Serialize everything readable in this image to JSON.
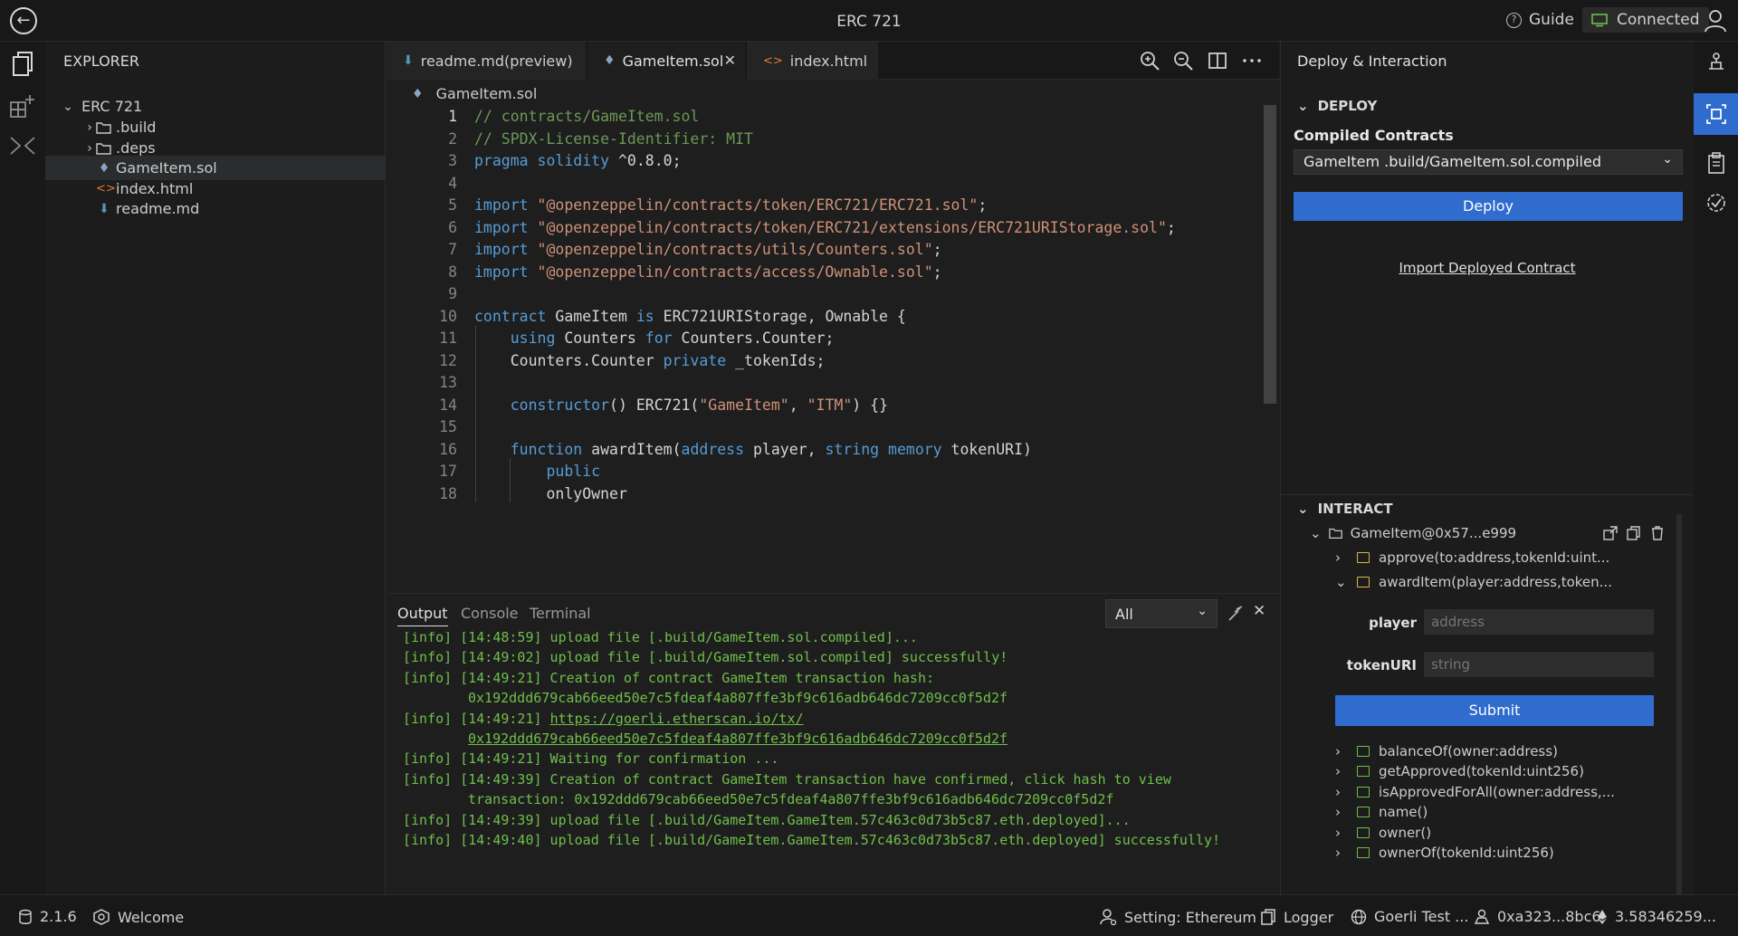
{
  "window": {
    "title": "ERC 721"
  },
  "titlebar": {
    "guide_label": "Guide",
    "connection_label": "Connected"
  },
  "explorer": {
    "title": "EXPLORER",
    "root": "ERC 721",
    "items": [
      {
        "label": ".build",
        "kind": "folder"
      },
      {
        "label": ".deps",
        "kind": "folder"
      },
      {
        "label": "GameItem.sol",
        "kind": "sol"
      },
      {
        "label": "index.html",
        "kind": "html"
      },
      {
        "label": "readme.md",
        "kind": "md"
      }
    ]
  },
  "editor": {
    "tabs": [
      {
        "label": "readme.md(preview)"
      },
      {
        "label": "GameItem.sol"
      },
      {
        "label": "index.html"
      }
    ],
    "close_glyph": "✕",
    "breadcrumb": "GameItem.sol",
    "lines": [
      {
        "n": "1",
        "text": "// contracts/GameItem.sol"
      },
      {
        "n": "2",
        "text": "// SPDX-License-Identifier: MIT"
      },
      {
        "n": "3",
        "text": "pragma solidity ^0.8.0;"
      },
      {
        "n": "4",
        "text": ""
      },
      {
        "n": "5",
        "text": "import \"@openzeppelin/contracts/token/ERC721/ERC721.sol\";"
      },
      {
        "n": "6",
        "text": "import \"@openzeppelin/contracts/token/ERC721/extensions/ERC721URIStorage.sol\";"
      },
      {
        "n": "7",
        "text": "import \"@openzeppelin/contracts/utils/Counters.sol\";"
      },
      {
        "n": "8",
        "text": "import \"@openzeppelin/contracts/access/Ownable.sol\";"
      },
      {
        "n": "9",
        "text": ""
      },
      {
        "n": "10",
        "text": "contract GameItem is ERC721URIStorage, Ownable {"
      },
      {
        "n": "11",
        "text": "    using Counters for Counters.Counter;"
      },
      {
        "n": "12",
        "text": "    Counters.Counter private _tokenIds;"
      },
      {
        "n": "13",
        "text": ""
      },
      {
        "n": "14",
        "text": "    constructor() ERC721(\"GameItem\", \"ITM\") {}"
      },
      {
        "n": "15",
        "text": ""
      },
      {
        "n": "16",
        "text": "    function awardItem(address player, string memory tokenURI)"
      },
      {
        "n": "17",
        "text": "        public"
      },
      {
        "n": "18",
        "text": "        onlyOwner"
      }
    ]
  },
  "panel": {
    "tabs": [
      "Output",
      "Console",
      "Terminal"
    ],
    "filter_value": "All",
    "logs": [
      {
        "text": "[info] [14:48:59] upload file [.build/GameItem.sol.compiled]..."
      },
      {
        "text": "[info] [14:49:02] upload file [.build/GameItem.sol.compiled] successfully!"
      },
      {
        "text": "[info] [14:49:21] Creation of contract GameItem transaction hash:"
      },
      {
        "text": "0x192ddd679cab66eed50e7c5fdeaf4a807ffe3bf9c616adb646dc7209cc0f5d2f",
        "cont": true
      },
      {
        "text": "[info] [14:49:21] ",
        "link": "https://goerli.etherscan.io/tx/"
      },
      {
        "text": "",
        "link": "0x192ddd679cab66eed50e7c5fdeaf4a807ffe3bf9c616adb646dc7209cc0f5d2f",
        "cont": true
      },
      {
        "text": "[info] [14:49:21] Waiting for confirmation ..."
      },
      {
        "text": "[info] [14:49:39] Creation of contract GameItem transaction have confirmed, click hash to view"
      },
      {
        "text": "transaction: 0x192ddd679cab66eed50e7c5fdeaf4a807ffe3bf9c616adb646dc7209cc0f5d2f",
        "cont": true
      },
      {
        "text": "[info] [14:49:39] upload file [.build/GameItem.GameItem.57c463c0d73b5c87.eth.deployed]..."
      },
      {
        "text": "[info] [14:49:40] upload file [.build/GameItem.GameItem.57c463c0d73b5c87.eth.deployed] successfully!"
      }
    ]
  },
  "deploy": {
    "title": "Deploy & Interaction",
    "deploy_header": "DEPLOY",
    "compiled_label": "Compiled Contracts",
    "compiled_value": "GameItem .build/GameItem.sol.compiled",
    "deploy_button": "Deploy",
    "import_link": "Import Deployed Contract",
    "interact_header": "INTERACT",
    "instance": "GameItem@0x57...e999",
    "functions_top": [
      {
        "label": "approve(to:address,tokenId:uint...",
        "expanded": false,
        "readonly": false
      },
      {
        "label": "awardItem(player:address,token...",
        "expanded": true,
        "readonly": false
      }
    ],
    "params": [
      {
        "label": "player",
        "placeholder": "address"
      },
      {
        "label": "tokenURI",
        "placeholder": "string"
      }
    ],
    "submit_button": "Submit",
    "functions_bottom": [
      {
        "label": "balanceOf(owner:address)"
      },
      {
        "label": "getApproved(tokenId:uint256)"
      },
      {
        "label": "isApprovedForAll(owner:address,..."
      },
      {
        "label": "name()"
      },
      {
        "label": "owner()"
      },
      {
        "label": "ownerOf(tokenId:uint256)"
      }
    ]
  },
  "statusbar": {
    "version": "2.1.6",
    "welcome": "Welcome",
    "setting": "Setting: Ethereum",
    "logger": "Logger",
    "network": "Goerli Test ...",
    "account": "0xa323...8bc6",
    "balance": "3.58346259..."
  },
  "colors": {
    "accent": "#2f6ccd",
    "log_green": "#6fbf4a",
    "keyword": "#569cd6",
    "string": "#ce9178",
    "comment": "#6a9955"
  }
}
